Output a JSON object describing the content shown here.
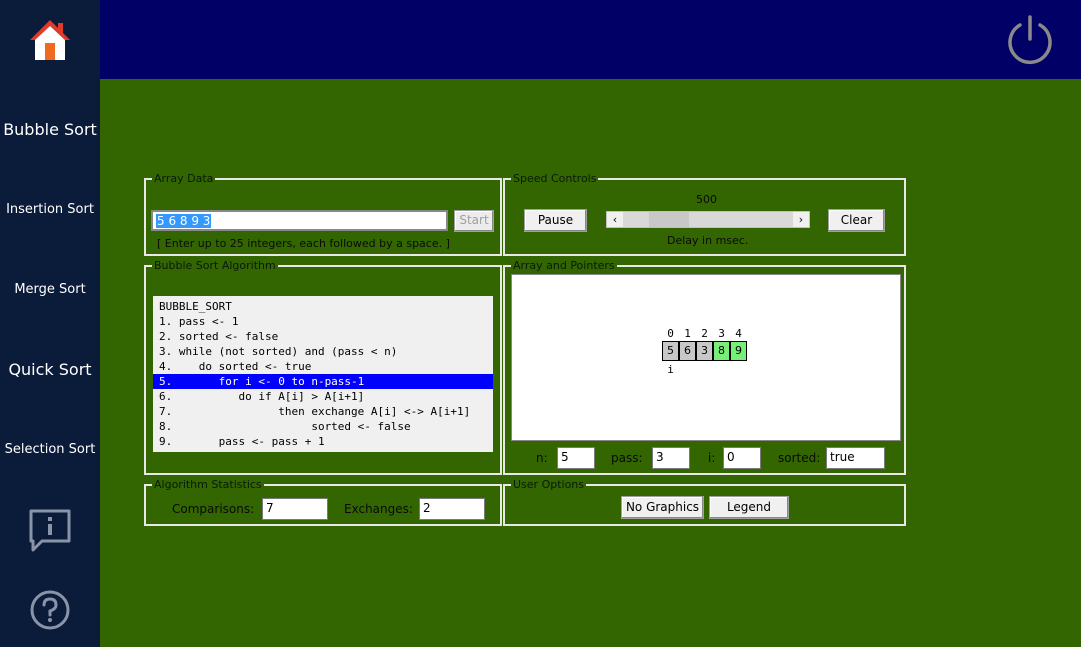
{
  "sidebar": {
    "items": [
      {
        "label": "Bubble Sort"
      },
      {
        "label": "Insertion Sort"
      },
      {
        "label": "Merge Sort"
      },
      {
        "label": "Quick Sort"
      },
      {
        "label": "Selection Sort"
      }
    ]
  },
  "array_data": {
    "legend": "Array Data",
    "value": "5 6 8 9 3",
    "start_label": "Start",
    "hint": "[ Enter up to 25 integers, each followed by a space. ]"
  },
  "speed": {
    "legend": "Speed Controls",
    "value_label": "500",
    "pause_label": "Pause",
    "clear_label": "Clear",
    "delay_label": "Delay in msec.",
    "slider_level": 0.2
  },
  "algorithm": {
    "legend": "Bubble Sort Algorithm",
    "lines": [
      "BUBBLE_SORT",
      "1. pass <- 1",
      "2. sorted <- false",
      "3. while (not sorted) and (pass < n)",
      "4.    do sorted <- true",
      "5.       for i <- 0 to n-pass-1",
      "6.          do if A[i] > A[i+1]",
      "7.                then exchange A[i] <-> A[i+1]",
      "8.                     sorted <- false",
      "9.       pass <- pass + 1"
    ],
    "highlighted_line": 5
  },
  "pointers": {
    "legend": "Array and Pointers",
    "indices": [
      "0",
      "1",
      "2",
      "3",
      "4"
    ],
    "cells": [
      {
        "value": "5",
        "state": "gray"
      },
      {
        "value": "6",
        "state": "gray"
      },
      {
        "value": "3",
        "state": "gray"
      },
      {
        "value": "8",
        "state": "green"
      },
      {
        "value": "9",
        "state": "green"
      }
    ],
    "pointer_label": "i",
    "n_label": "n:",
    "n_value": "5",
    "pass_label": "pass:",
    "pass_value": "3",
    "i_label": "i:",
    "i_value": "0",
    "sorted_label": "sorted:",
    "sorted_value": "true"
  },
  "stats": {
    "legend": "Algorithm Statistics",
    "comparisons_label": "Comparisons:",
    "comparisons_value": "7",
    "exchanges_label": "Exchanges:",
    "exchanges_value": "2"
  },
  "options": {
    "legend": "User Options",
    "no_graphics_label": "No Graphics",
    "legend_label": "Legend"
  },
  "colors": {
    "sidebar": "#0b1b3a",
    "topbar": "#000066",
    "background": "#336600",
    "highlight": "#0000ff",
    "sorted_cell": "#77ee77"
  }
}
